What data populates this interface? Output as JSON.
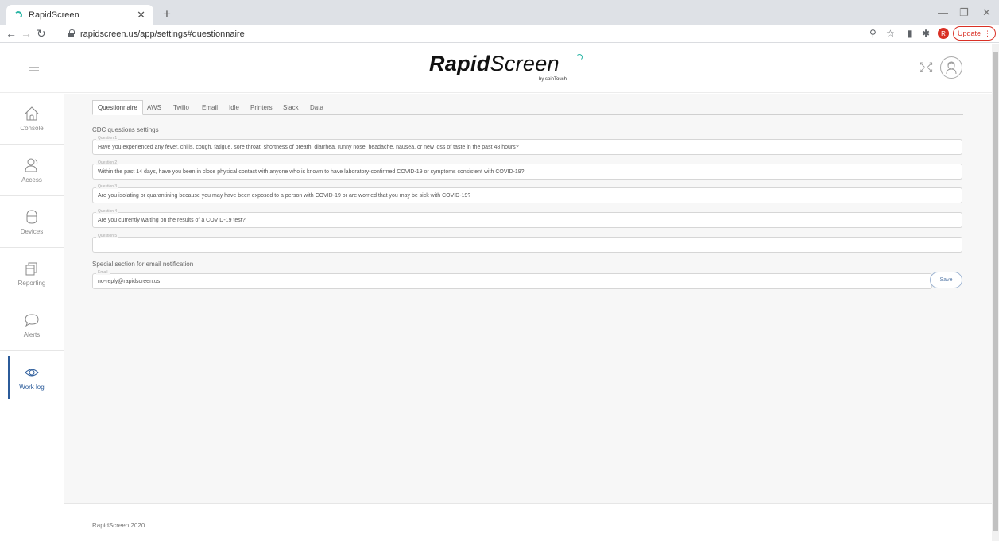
{
  "browser": {
    "tab_title": "RapidScreen",
    "url": "rapidscreen.us/app/settings#questionnaire",
    "profile_initial": "R",
    "update_label": "Update"
  },
  "header": {
    "logo_bold": "Rapid",
    "logo_light": "Screen",
    "logo_sub": "by spinTouch"
  },
  "sidebar": {
    "items": [
      {
        "label": "Console",
        "icon": "home-icon"
      },
      {
        "label": "Access",
        "icon": "users-icon"
      },
      {
        "label": "Devices",
        "icon": "device-icon"
      },
      {
        "label": "Reporting",
        "icon": "reports-icon"
      },
      {
        "label": "Alerts",
        "icon": "chat-bubble-icon"
      },
      {
        "label": "Work log",
        "icon": "eye-icon",
        "active": true
      }
    ]
  },
  "tabs": [
    "Questionnaire",
    "AWS",
    "Twilio",
    "Email",
    "Idle",
    "Printers",
    "Slack",
    "Data"
  ],
  "questions_section": {
    "title": "CDC questions settings",
    "questions": [
      {
        "legend": "Question 1",
        "value": "Have you experienced any fever, chills, cough, fatigue, sore throat, shortness of breath, diarrhea, runny nose, headache, nausea, or new loss of taste in the past 48 hours?"
      },
      {
        "legend": "Question 2",
        "value": "Within the past 14 days, have you been in close physical contact with anyone who is known to have laboratory-confirmed COVID-19 or symptoms consistent with COVID-19?"
      },
      {
        "legend": "Question 3",
        "value": "Are you isolating or quarantining because you may have been exposed to a person with COVID-19 or are worried that you may be sick with COVID-19?"
      },
      {
        "legend": "Question 4",
        "value": "Are you currently waiting on the results of a COVID-19 test?"
      },
      {
        "legend": "Question 5",
        "value": ""
      }
    ]
  },
  "email_section": {
    "title": "Special section for email notification",
    "legend": "Email",
    "value": "no-reply@rapidscreen.us",
    "save_label": "Save"
  },
  "footer": {
    "text": "RapidScreen 2020"
  },
  "colors": {
    "accent": "#2b5b9a",
    "brand_teal": "#2ab5a5",
    "update_red": "#d93025"
  }
}
